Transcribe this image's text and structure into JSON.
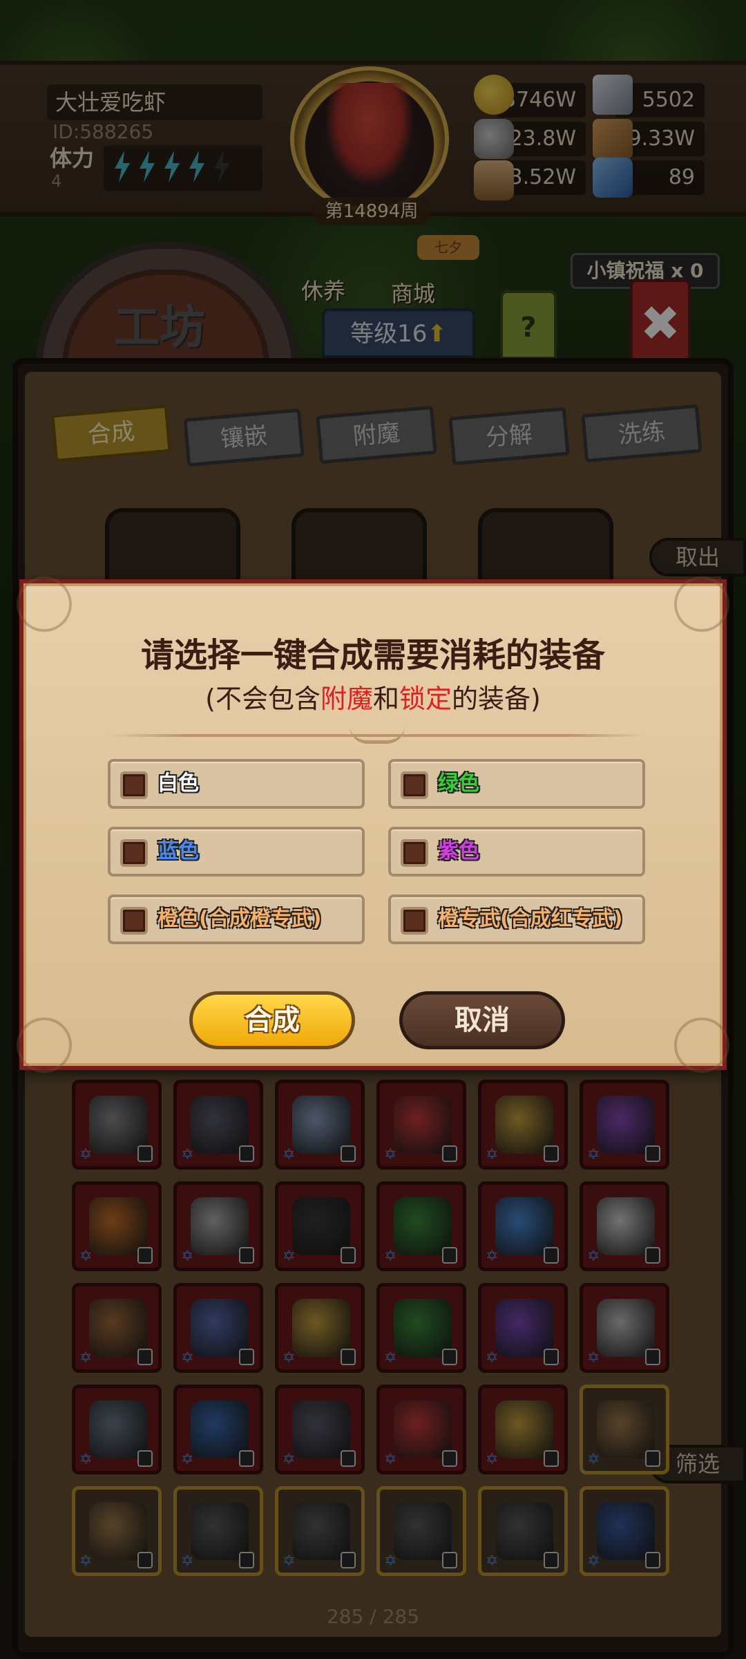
{
  "header": {
    "player_name": "大壮爱吃虾",
    "player_id": "ID:588265",
    "stamina_label": "体力",
    "stamina_value": "4",
    "week": "第14894周",
    "resources": [
      {
        "icon": "gold-coin-icon",
        "value": "3746W"
      },
      {
        "icon": "iron-ingot-icon",
        "value": "5502"
      },
      {
        "icon": "stone-icon",
        "value": "23.8W"
      },
      {
        "icon": "leather-icon",
        "value": "9.33W"
      },
      {
        "icon": "wood-log-icon",
        "value": "3.52W"
      },
      {
        "icon": "crystal-icon",
        "value": "89"
      }
    ]
  },
  "nav": {
    "rest_label": "休养",
    "shop_label": "商城",
    "shop_badge": "七夕",
    "blessing": "小镇祝福 x 0",
    "workshop_title": "工坊",
    "level_label": "等级16",
    "help_label": "?"
  },
  "workshop": {
    "tabs": [
      {
        "label": "合成",
        "active": true
      },
      {
        "label": "镶嵌",
        "active": false
      },
      {
        "label": "附魔",
        "active": false
      },
      {
        "label": "分解",
        "active": false
      },
      {
        "label": "洗练",
        "active": false
      }
    ],
    "take_out_label": "取出",
    "filter_label": "筛选",
    "page_count": "285 / 285"
  },
  "dialog": {
    "title": "请选择一键合成需要消耗的装备",
    "subtitle_prefix": "(不会包含",
    "subtitle_red1": "附魔",
    "subtitle_mid": "和",
    "subtitle_red2": "锁定",
    "subtitle_suffix": "的装备)",
    "options": [
      {
        "label": "白色",
        "color": "#ffffff",
        "checked": false
      },
      {
        "label": "绿色",
        "color": "#35d035",
        "checked": false
      },
      {
        "label": "蓝色",
        "color": "#4a8af0",
        "checked": false
      },
      {
        "label": "紫色",
        "color": "#d040e0",
        "checked": false
      },
      {
        "label": "橙色(合成橙专武)",
        "color": "#f7b06a",
        "checked": false
      },
      {
        "label": "橙专武(合成红专武)",
        "color": "#f7b06a",
        "checked": false
      }
    ],
    "confirm_label": "合成",
    "cancel_label": "取消"
  },
  "colors": {
    "item_slot_red": "#6a1a1a",
    "item_slot_gold_border": "#b8922e",
    "accent_gold": "#f0a808",
    "dialog_border": "#7a1f1f"
  }
}
